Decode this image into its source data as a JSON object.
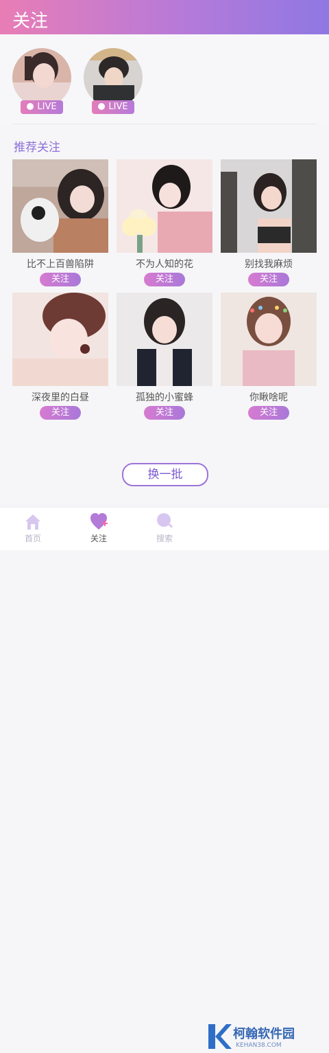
{
  "header": {
    "title": "关注"
  },
  "following": [
    {
      "badge": "LIVE"
    },
    {
      "badge": "LIVE"
    }
  ],
  "recommend": {
    "title": "推荐关注",
    "cards": [
      {
        "name": "比不上百兽陷阱",
        "button": "关注"
      },
      {
        "name": "不为人知的花",
        "button": "关注"
      },
      {
        "name": "别找我麻烦",
        "button": "关注"
      },
      {
        "name": "深夜里的白昼",
        "button": "关注"
      },
      {
        "name": "孤独的小蜜蜂",
        "button": "关注"
      },
      {
        "name": "你瞅啥呢",
        "button": "关注"
      }
    ],
    "refresh": "换一批"
  },
  "tabs": [
    {
      "label": "首页",
      "icon": "house-icon"
    },
    {
      "label": "关注",
      "icon": "heart-plus-icon"
    },
    {
      "label": "搜索",
      "icon": "search-icon"
    }
  ],
  "watermark": {
    "text": "柯翰软件园",
    "sub": "KEHAN38.COM"
  },
  "colors": {
    "accent_start": "#e97db5",
    "accent_end": "#8f78e3",
    "purple_text": "#8e6fd8"
  }
}
